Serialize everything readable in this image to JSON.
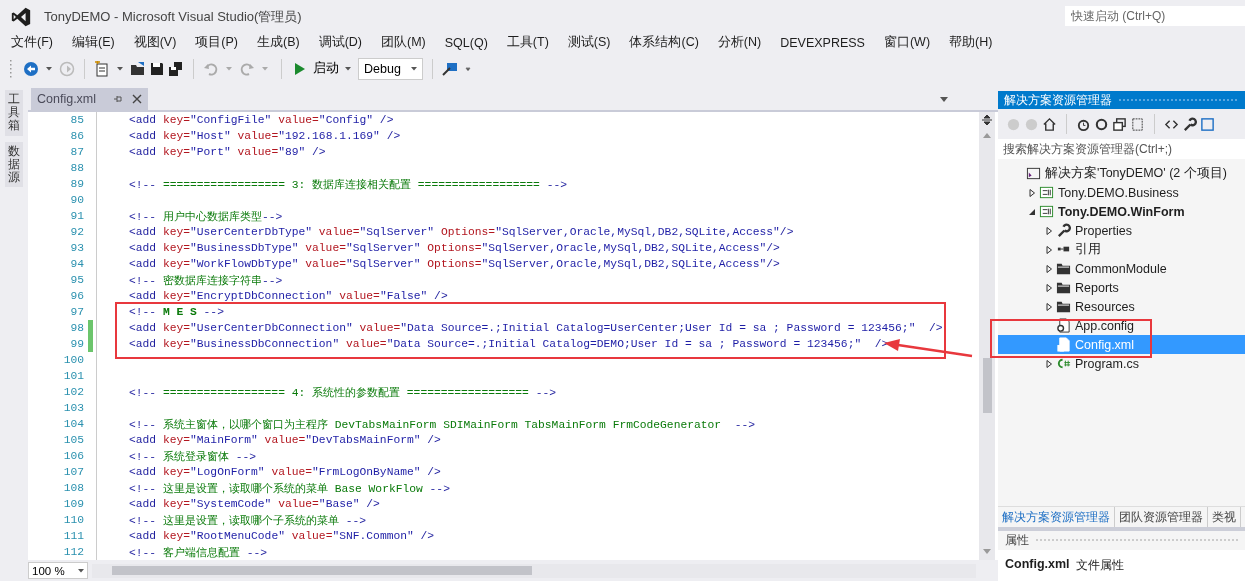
{
  "window": {
    "title": "TonyDEMO - Microsoft Visual Studio(管理员)",
    "quick_launch": {
      "placeholder": "快速启动 (Ctrl+Q)"
    }
  },
  "menu": [
    "文件(F)",
    "编辑(E)",
    "视图(V)",
    "项目(P)",
    "生成(B)",
    "调试(D)",
    "团队(M)",
    "SQL(Q)",
    "工具(T)",
    "测试(S)",
    "体系结构(C)",
    "分析(N)",
    "DEVEXPRESS",
    "窗口(W)",
    "帮助(H)"
  ],
  "toolbar": {
    "start_label": "启动",
    "configuration": "Debug"
  },
  "side_tabs": [
    "工具箱",
    "数据源"
  ],
  "document_tabs": [
    {
      "label": "Config.xml",
      "selected": true
    }
  ],
  "editor": {
    "zoom": "100 %",
    "lines": [
      {
        "n": "85",
        "changed": false,
        "seg": [
          {
            "kind": "tag",
            "t": "<add"
          },
          {
            "kind": "attr",
            "t": " key="
          },
          {
            "kind": "val",
            "t": "\"ConfigFile\""
          },
          {
            "kind": "attr",
            "t": " value="
          },
          {
            "kind": "val",
            "t": "\"Config\""
          },
          {
            "kind": "tag",
            "t": " />"
          }
        ]
      },
      {
        "n": "86",
        "changed": false,
        "seg": [
          {
            "kind": "tag",
            "t": "<add"
          },
          {
            "kind": "attr",
            "t": " key="
          },
          {
            "kind": "val",
            "t": "\"Host\""
          },
          {
            "kind": "attr",
            "t": " value="
          },
          {
            "kind": "val",
            "t": "\"192.168.1.169\""
          },
          {
            "kind": "tag",
            "t": " />"
          }
        ]
      },
      {
        "n": "87",
        "changed": false,
        "seg": [
          {
            "kind": "tag",
            "t": "<add"
          },
          {
            "kind": "attr",
            "t": " key="
          },
          {
            "kind": "val",
            "t": "\"Port\""
          },
          {
            "kind": "attr",
            "t": " value="
          },
          {
            "kind": "val",
            "t": "\"89\""
          },
          {
            "kind": "tag",
            "t": " />"
          }
        ]
      },
      {
        "n": "88",
        "changed": false
      },
      {
        "n": "89",
        "changed": false,
        "seg": [
          {
            "kind": "tag",
            "t": "<!--"
          },
          {
            "kind": "cmt",
            "t": " ================== 3: 数据库连接相关配置 ================== "
          },
          {
            "kind": "tag",
            "t": "-->"
          }
        ]
      },
      {
        "n": "90",
        "changed": false
      },
      {
        "n": "91",
        "changed": false,
        "seg": [
          {
            "kind": "tag",
            "t": "<!--"
          },
          {
            "kind": "cmt",
            "t": " 用户中心数据库类型"
          },
          {
            "kind": "tag",
            "t": "-->"
          }
        ]
      },
      {
        "n": "92",
        "changed": false,
        "seg": [
          {
            "kind": "tag",
            "t": "<add"
          },
          {
            "kind": "attr",
            "t": " key="
          },
          {
            "kind": "val",
            "t": "\"UserCenterDbType\""
          },
          {
            "kind": "attr",
            "t": " value="
          },
          {
            "kind": "val",
            "t": "\"SqlServer\""
          },
          {
            "kind": "attr",
            "t": " Options="
          },
          {
            "kind": "val",
            "t": "\"SqlServer,Oracle,MySql,DB2,SQLite,Access\""
          },
          {
            "kind": "tag",
            "t": "/>"
          }
        ]
      },
      {
        "n": "93",
        "changed": false,
        "seg": [
          {
            "kind": "tag",
            "t": "<add"
          },
          {
            "kind": "attr",
            "t": " key="
          },
          {
            "kind": "val",
            "t": "\"BusinessDbType\""
          },
          {
            "kind": "attr",
            "t": " value="
          },
          {
            "kind": "val",
            "t": "\"SqlServer\""
          },
          {
            "kind": "attr",
            "t": " Options="
          },
          {
            "kind": "val",
            "t": "\"SqlServer,Oracle,MySql,DB2,SQLite,Access\""
          },
          {
            "kind": "tag",
            "t": "/>"
          }
        ]
      },
      {
        "n": "94",
        "changed": false,
        "seg": [
          {
            "kind": "tag",
            "t": "<add"
          },
          {
            "kind": "attr",
            "t": " key="
          },
          {
            "kind": "val",
            "t": "\"WorkFlowDbType\""
          },
          {
            "kind": "attr",
            "t": " value="
          },
          {
            "kind": "val",
            "t": "\"SqlServer\""
          },
          {
            "kind": "attr",
            "t": " Options="
          },
          {
            "kind": "val",
            "t": "\"SqlServer,Oracle,MySql,DB2,SQLite,Access\""
          },
          {
            "kind": "tag",
            "t": "/>"
          }
        ]
      },
      {
        "n": "95",
        "changed": false,
        "seg": [
          {
            "kind": "tag",
            "t": "<!--"
          },
          {
            "kind": "cmt",
            "t": " 密数据库连接字符串"
          },
          {
            "kind": "tag",
            "t": "-->"
          }
        ]
      },
      {
        "n": "96",
        "changed": false,
        "seg": [
          {
            "kind": "tag",
            "t": "<add"
          },
          {
            "kind": "attr",
            "t": " key="
          },
          {
            "kind": "val",
            "t": "\"EncryptDbConnection\""
          },
          {
            "kind": "attr",
            "t": " value="
          },
          {
            "kind": "val",
            "t": "\"False\""
          },
          {
            "kind": "tag",
            "t": " />"
          }
        ]
      },
      {
        "n": "97",
        "changed": false,
        "seg": [
          {
            "kind": "tag",
            "t": "<!--"
          },
          {
            "kind": "cmt",
            "t": " **M E S** "
          },
          {
            "kind": "tag",
            "t": "-->"
          }
        ]
      },
      {
        "n": "98",
        "changed": true,
        "seg": [
          {
            "kind": "tag",
            "t": "<add"
          },
          {
            "kind": "attr",
            "t": " key="
          },
          {
            "kind": "val",
            "t": "\"UserCenterDbConnection\""
          },
          {
            "kind": "attr",
            "t": " value="
          },
          {
            "kind": "val",
            "t": "\"Data Source=.;Initial Catalog=UserCenter;User Id = sa ; Password = 123456;\""
          },
          {
            "kind": "tag",
            "t": "  />"
          }
        ]
      },
      {
        "n": "99",
        "changed": true,
        "seg": [
          {
            "kind": "tag",
            "t": "<add"
          },
          {
            "kind": "attr",
            "t": " key="
          },
          {
            "kind": "val",
            "t": "\"BusinessDbConnection\""
          },
          {
            "kind": "attr",
            "t": " value="
          },
          {
            "kind": "val",
            "t": "\"Data Source=.;Initial Catalog=DEMO;User Id = sa ; Password = 123456;\""
          },
          {
            "kind": "tag",
            "t": "  />"
          }
        ]
      },
      {
        "n": "100",
        "changed": false
      },
      {
        "n": "101",
        "changed": false
      },
      {
        "n": "102",
        "changed": false,
        "seg": [
          {
            "kind": "tag",
            "t": "<!--"
          },
          {
            "kind": "cmt",
            "t": " ================== 4: 系统性的参数配置 ================== "
          },
          {
            "kind": "tag",
            "t": "-->"
          }
        ]
      },
      {
        "n": "103",
        "changed": false
      },
      {
        "n": "104",
        "changed": false,
        "seg": [
          {
            "kind": "tag",
            "t": "<!--"
          },
          {
            "kind": "cmt",
            "t": " 系统主窗体，以哪个窗口为主程序 DevTabsMainForm SDIMainForm TabsMainForm FrmCodeGenerator  "
          },
          {
            "kind": "tag",
            "t": "-->"
          }
        ]
      },
      {
        "n": "105",
        "changed": false,
        "seg": [
          {
            "kind": "tag",
            "t": "<add"
          },
          {
            "kind": "attr",
            "t": " key="
          },
          {
            "kind": "val",
            "t": "\"MainForm\""
          },
          {
            "kind": "attr",
            "t": " value="
          },
          {
            "kind": "val",
            "t": "\"DevTabsMainForm\""
          },
          {
            "kind": "tag",
            "t": " />"
          }
        ]
      },
      {
        "n": "106",
        "changed": false,
        "seg": [
          {
            "kind": "tag",
            "t": "<!--"
          },
          {
            "kind": "cmt",
            "t": " 系统登录窗体 "
          },
          {
            "kind": "tag",
            "t": "-->"
          }
        ]
      },
      {
        "n": "107",
        "changed": false,
        "seg": [
          {
            "kind": "tag",
            "t": "<add"
          },
          {
            "kind": "attr",
            "t": " key="
          },
          {
            "kind": "val",
            "t": "\"LogOnForm\""
          },
          {
            "kind": "attr",
            "t": " value="
          },
          {
            "kind": "val",
            "t": "\"FrmLogOnByName\""
          },
          {
            "kind": "tag",
            "t": " />"
          }
        ]
      },
      {
        "n": "108",
        "changed": false,
        "seg": [
          {
            "kind": "tag",
            "t": "<!--"
          },
          {
            "kind": "cmt",
            "t": " 这里是设置，读取哪个系统的菜单 Base WorkFlow "
          },
          {
            "kind": "tag",
            "t": "-->"
          }
        ]
      },
      {
        "n": "109",
        "changed": false,
        "seg": [
          {
            "kind": "tag",
            "t": "<add"
          },
          {
            "kind": "attr",
            "t": " key="
          },
          {
            "kind": "val",
            "t": "\"SystemCode\""
          },
          {
            "kind": "attr",
            "t": " value="
          },
          {
            "kind": "val",
            "t": "\"Base\""
          },
          {
            "kind": "tag",
            "t": " />"
          }
        ]
      },
      {
        "n": "110",
        "changed": false,
        "seg": [
          {
            "kind": "tag",
            "t": "<!--"
          },
          {
            "kind": "cmt",
            "t": " 这里是设置，读取哪个子系统的菜单 "
          },
          {
            "kind": "tag",
            "t": "-->"
          }
        ]
      },
      {
        "n": "111",
        "changed": false,
        "seg": [
          {
            "kind": "tag",
            "t": "<add"
          },
          {
            "kind": "attr",
            "t": " key="
          },
          {
            "kind": "val",
            "t": "\"RootMenuCode\""
          },
          {
            "kind": "attr",
            "t": " value="
          },
          {
            "kind": "val",
            "t": "\"SNF.Common\""
          },
          {
            "kind": "tag",
            "t": " />"
          }
        ]
      },
      {
        "n": "112",
        "changed": false,
        "seg": [
          {
            "kind": "tag",
            "t": "<!--"
          },
          {
            "kind": "cmt",
            "t": " 客户端信息配置 "
          },
          {
            "kind": "tag",
            "t": "-->"
          }
        ]
      }
    ]
  },
  "explorer": {
    "title": "解决方案资源管理器",
    "search": {
      "placeholder": "搜索解决方案资源管理器(Ctrl+;)"
    },
    "tree": [
      {
        "label": "解决方案'TonyDEMO' (2 个项目)",
        "kind": "solution",
        "selected": false,
        "bold": false,
        "children": [
          {
            "label": "Tony.DEMO.Business",
            "kind": "project",
            "selected": false,
            "bold": false,
            "expanded": false
          },
          {
            "label": "Tony.DEMO.WinForm",
            "kind": "project",
            "selected": false,
            "bold": true,
            "expanded": true,
            "children": [
              {
                "label": "Properties",
                "kind": "wrench",
                "selected": false,
                "bold": false,
                "expanded": false
              },
              {
                "label": "引用",
                "kind": "references",
                "selected": false,
                "bold": false,
                "expanded": false
              },
              {
                "label": "CommonModule",
                "kind": "folder",
                "selected": false,
                "bold": false,
                "expanded": false
              },
              {
                "label": "Reports",
                "kind": "folder",
                "selected": false,
                "bold": false,
                "expanded": false
              },
              {
                "label": "Resources",
                "kind": "folder",
                "selected": false,
                "bold": false,
                "expanded": false
              },
              {
                "label": "App.config",
                "kind": "config",
                "selected": false,
                "bold": false
              },
              {
                "label": "Config.xml",
                "kind": "xml",
                "selected": true,
                "bold": false
              },
              {
                "label": "Program.cs",
                "kind": "csharp",
                "selected": false,
                "bold": false,
                "expanded": false
              }
            ]
          }
        ]
      }
    ],
    "bottom_tabs": [
      {
        "label": "解决方案资源管理器",
        "selected": true
      },
      {
        "label": "团队资源管理器",
        "selected": false
      },
      {
        "label": "类视",
        "selected": false
      }
    ]
  },
  "properties": {
    "title": "属性",
    "object": "Config.xml",
    "object_type": "文件属性"
  }
}
